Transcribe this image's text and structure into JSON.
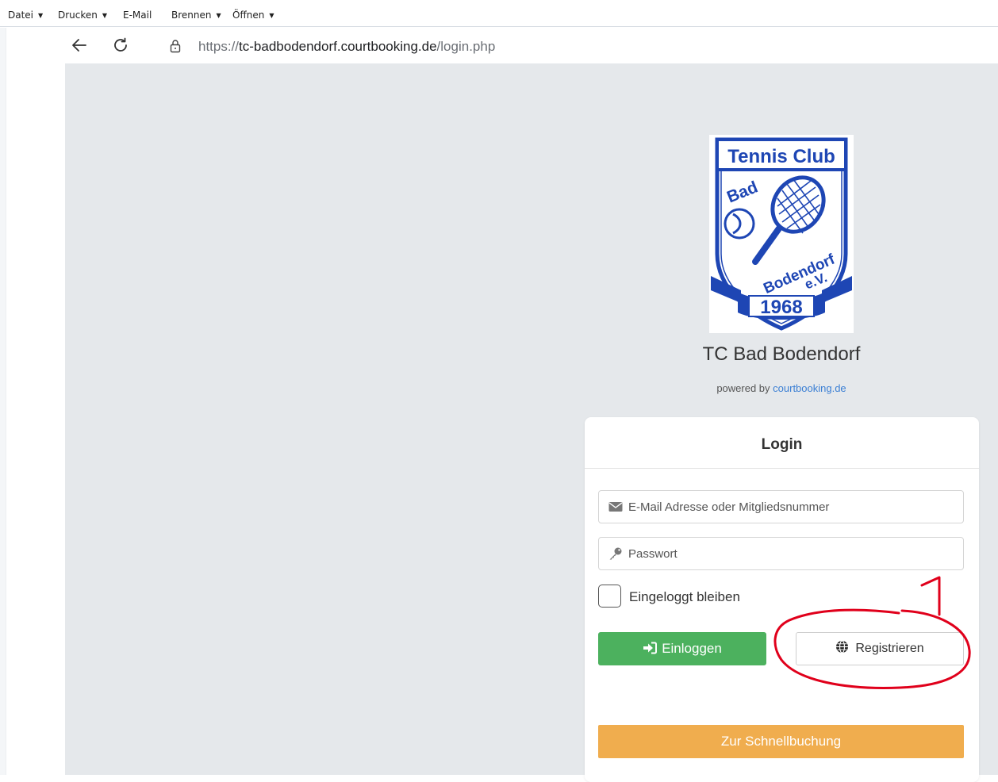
{
  "menu": {
    "items": [
      {
        "label": "Datei",
        "caret": "▼"
      },
      {
        "label": "Drucken",
        "caret": "▼"
      },
      {
        "label": "E-Mail",
        "caret": ""
      },
      {
        "label": "Brennen",
        "caret": "▼"
      },
      {
        "label": "Öffnen",
        "caret": "▼"
      }
    ]
  },
  "browser": {
    "url_scheme": "https://",
    "url_host": "tc-badbodendorf.courtbooking.de",
    "url_path": "/login.php"
  },
  "logo": {
    "line1": "Tennis Club",
    "word_bad": "Bad",
    "word_bodendorf": "Bodendorf",
    "word_ev": "e.V.",
    "year": "1968"
  },
  "club": {
    "name": "TC Bad Bodendorf",
    "powered_prefix": "powered by",
    "powered_link": "courtbooking.de"
  },
  "login": {
    "title": "Login",
    "email_placeholder": "E-Mail Adresse oder Mitgliedsnummer",
    "password_placeholder": "Passwort",
    "remember_label": "Eingeloggt bleiben",
    "login_button": "Einloggen",
    "register_button": "Registrieren",
    "quick_booking_button": "Zur Schnellbuchung"
  },
  "annotation": {
    "number": "1",
    "color": "#e0001b"
  },
  "colors": {
    "login_green": "#4cb15e",
    "quick_orange": "#f0ad4e",
    "logo_blue": "#1e46b4",
    "page_gray": "#e5e8eb"
  }
}
